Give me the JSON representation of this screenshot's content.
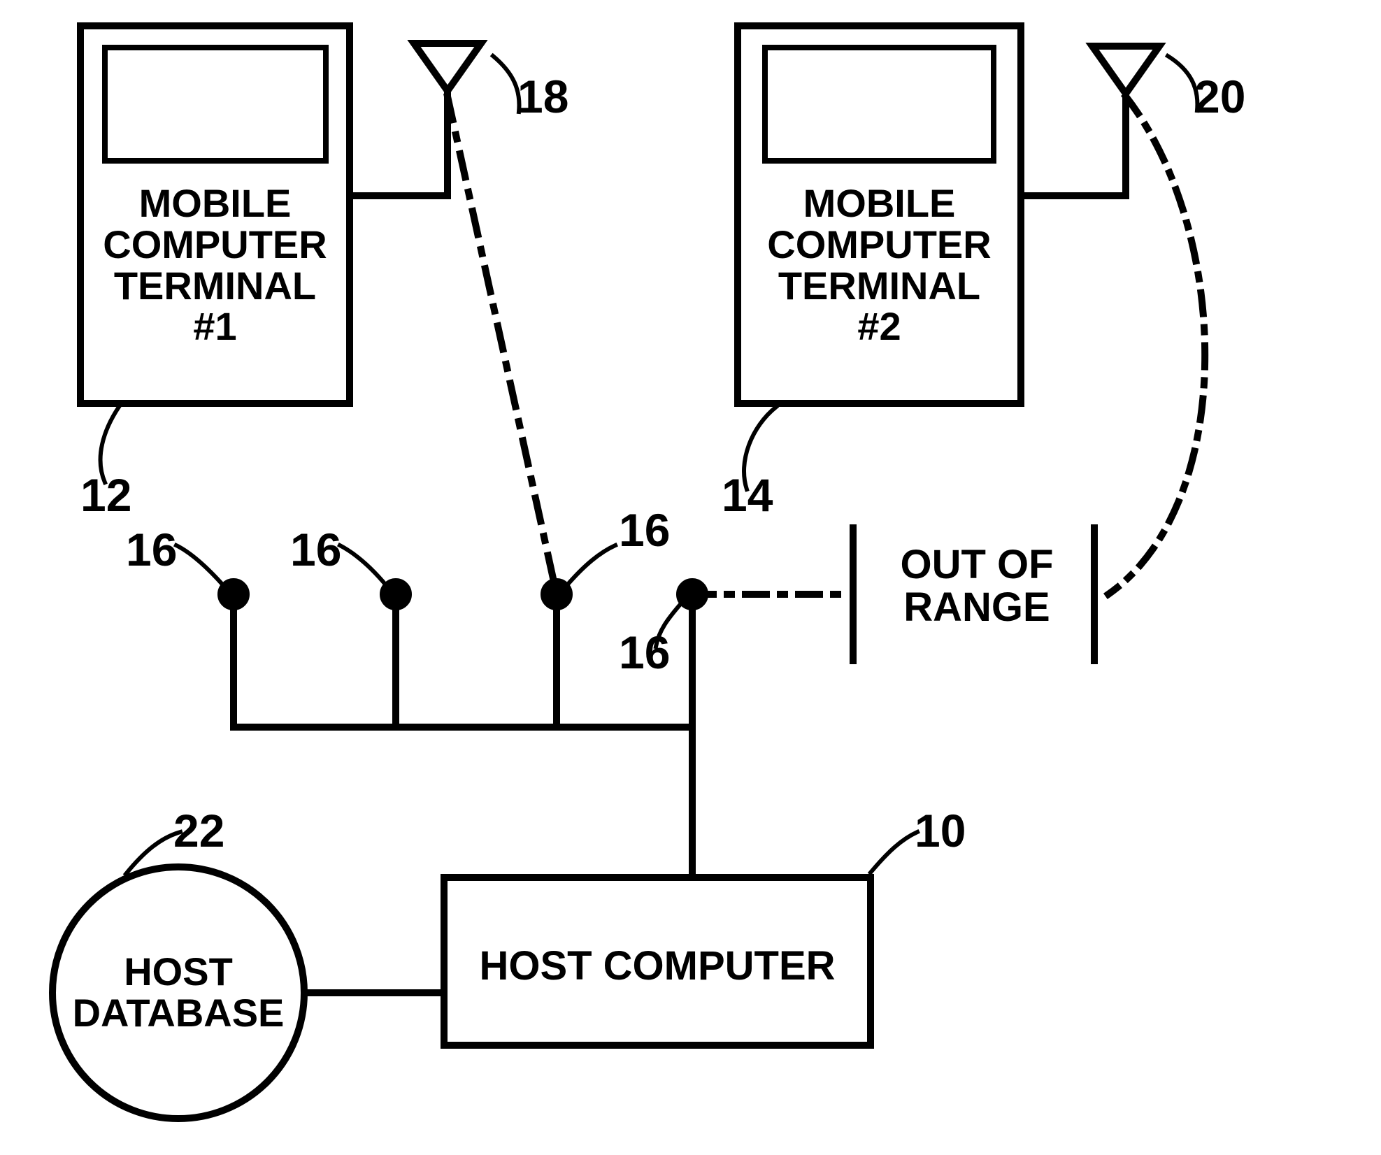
{
  "terminal1": {
    "label": "MOBILE\nCOMPUTER\nTERMINAL\n#1",
    "ref": "12",
    "antenna_ref": "18"
  },
  "terminal2": {
    "label": "MOBILE\nCOMPUTER\nTERMINAL\n#2",
    "ref": "14",
    "antenna_ref": "20"
  },
  "access_points": {
    "ref": "16"
  },
  "out_of_range": {
    "label": "OUT OF\nRANGE"
  },
  "host_computer": {
    "label": "HOST COMPUTER",
    "ref": "10"
  },
  "host_database": {
    "label": "HOST\nDATABASE",
    "ref": "22"
  }
}
